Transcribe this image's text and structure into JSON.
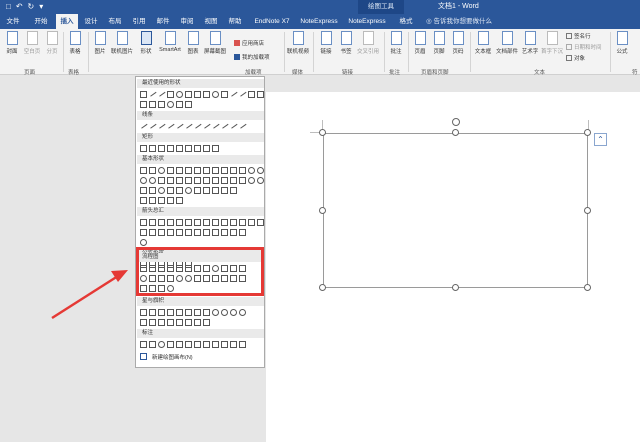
{
  "titlebar": {
    "save_icon": "save-icon",
    "undo_icon": "undo-icon",
    "redo_icon": "redo-icon",
    "tools_label": "绘图工具",
    "doc_title": "文档1 - Word"
  },
  "tabs": [
    "文件",
    "开始",
    "插入",
    "设计",
    "布局",
    "引用",
    "邮件",
    "审阅",
    "视图",
    "帮助",
    "EndNote X7",
    "NoteExpress",
    "NoteExpress",
    "格式"
  ],
  "active_tab": "插入",
  "tell_me": "告诉我你想要做什么",
  "ribbon": {
    "buttons": [
      "封面",
      "空白页",
      "分页",
      "表格",
      "图片",
      "联机图片",
      "形状",
      "SmartArt",
      "图表",
      "屏幕截图",
      "联机视频",
      "链接",
      "书签",
      "交叉引用",
      "批注",
      "页眉",
      "页脚",
      "页码",
      "文本框",
      "文档部件",
      "艺术字",
      "首字下沉",
      "公式"
    ],
    "small_buttons": [
      "应用商店",
      "我的加载项",
      "签名行",
      "日期和时间",
      "对象"
    ],
    "groups": [
      "页面",
      "表格",
      "插图",
      "加载项",
      "媒体",
      "链接",
      "批注",
      "页眉和页脚",
      "文本",
      "符"
    ]
  },
  "gallery": {
    "sections": [
      "最近使用的形状",
      "线条",
      "矩形",
      "基本形状",
      "箭头总汇",
      "公式形状",
      "流程图",
      "星与旗帜",
      "标注"
    ],
    "footer": "新建绘图画布(N)"
  },
  "highlight_color": "#e53935",
  "accent_color": "#2b579a"
}
